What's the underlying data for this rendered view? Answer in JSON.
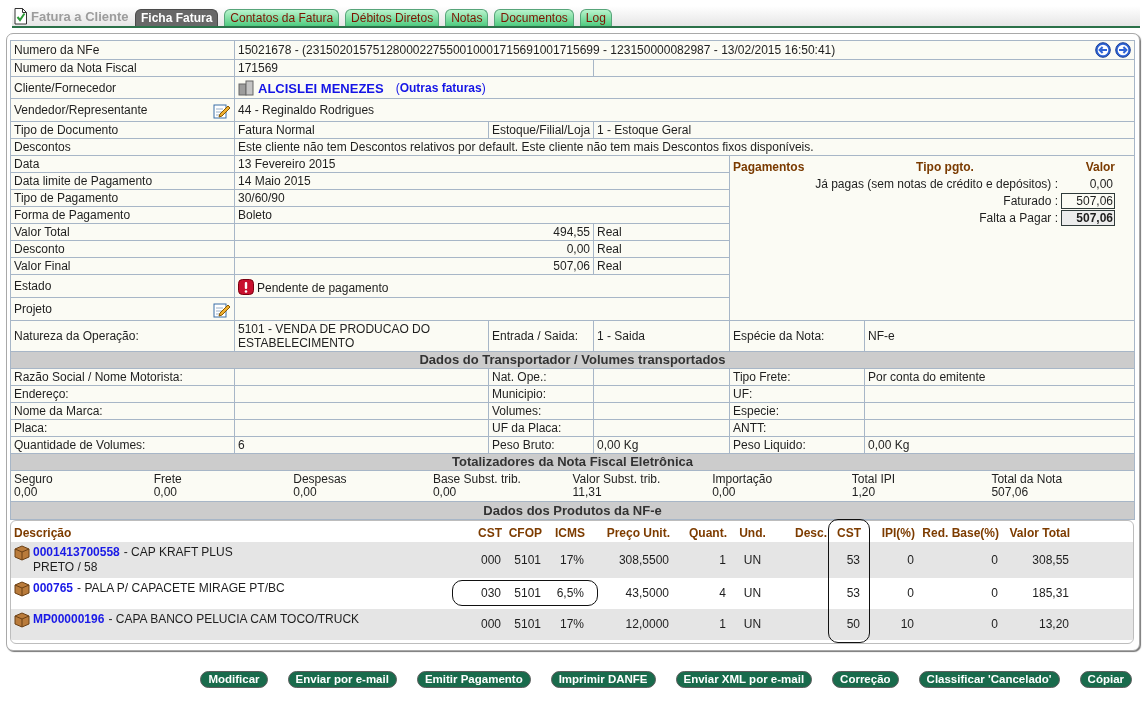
{
  "page": {
    "title": "Fatura a Cliente"
  },
  "tabs": [
    {
      "label": "Ficha Fatura",
      "selected": true
    },
    {
      "label": "Contatos da Fatura",
      "selected": false
    },
    {
      "label": "Débitos Diretos",
      "selected": false
    },
    {
      "label": "Notas",
      "selected": false
    },
    {
      "label": "Documentos",
      "selected": false
    },
    {
      "label": "Log",
      "selected": false
    }
  ],
  "details": {
    "nfe": {
      "label": "Numero da NFe",
      "value": "15021678 - (23150201575128000227550010001715691001715699 - 123150000082987 - 13/02/2015 16:50:41)"
    },
    "nota_fiscal": {
      "label": "Numero da Nota Fiscal",
      "value": "171569"
    },
    "client": {
      "label": "Cliente/Fornecedor",
      "name": "ALCISLEI MENEZES",
      "other_link": "(**Outras faturas**)"
    },
    "seller": {
      "label": "Vendedor/Representante",
      "value": "44 - Reginaldo Rodrigues"
    },
    "document": {
      "label": "Tipo de Documento",
      "value": "Fatura Normal",
      "stock_label": "Estoque/Filial/Loja",
      "stock_value": "1 - Estoque Geral"
    },
    "discounts": {
      "label": "Descontos",
      "value": "Este cliente não tem Descontos relativos por default. Este cliente não tem mais Descontos fixos disponíveis."
    },
    "fields": [
      {
        "label": "Data",
        "value": "13 Fevereiro 2015"
      },
      {
        "label": "Data limite de Pagamento",
        "value": "14 Maio 2015"
      },
      {
        "label": "Tipo de Pagamento",
        "value": "30/60/90"
      },
      {
        "label": "Forma de Pagamento",
        "value": "Boleto"
      }
    ],
    "amounts": [
      {
        "label": "Valor Total",
        "value": "494,55",
        "currency": "Real"
      },
      {
        "label": "Desconto",
        "value": "0,00",
        "currency": "Real"
      },
      {
        "label": "Valor Final",
        "value": "507,06",
        "currency": "Real"
      }
    ],
    "status": {
      "label": "Estado",
      "value": "Pendente de pagamento"
    },
    "project": {
      "label": "Projeto"
    },
    "operation": {
      "label": "Natureza da Operação:",
      "value": "5101 - VENDA DE PRODUCAO DO ESTABELECIMENTO",
      "io_label": "Entrada / Saida:",
      "io_value": "1 - Saida",
      "species_label": "Espécie da Nota:",
      "species_value": "NF-e"
    }
  },
  "payments": {
    "title": "Pagamentos",
    "type_heading": "Tipo pgto.",
    "value_heading": "Valor",
    "lines": [
      {
        "label": "Já pagas (sem notas de crédito e depósitos) :",
        "value": "0,00",
        "kind": "plain"
      },
      {
        "label": "Faturado :",
        "value": "507,06",
        "kind": "boxed"
      },
      {
        "label": "Falta a Pagar :",
        "value": "507,06",
        "kind": "total"
      }
    ]
  },
  "transport": {
    "title": "Dados do Transportador / Volumes transportados",
    "rows": [
      [
        {
          "label": "Razão Social / Nome Motorista:"
        },
        {
          "label": "Nat. Ope.:"
        },
        {
          "label": "Tipo Frete:",
          "value": "Por conta do emitente"
        }
      ],
      [
        {
          "label": "Endereço:"
        },
        {
          "label": "Municipio:"
        },
        {
          "label": "UF:"
        }
      ],
      [
        {
          "label": "Nome da Marca:"
        },
        {
          "label": "Volumes:"
        },
        {
          "label": "Especie:"
        }
      ],
      [
        {
          "label": "Placa:"
        },
        {
          "label": "UF da Placa:"
        },
        {
          "label": "ANTT:"
        }
      ],
      [
        {
          "label": "Quantidade de Volumes:",
          "value": "6"
        },
        {
          "label": "Peso Bruto:",
          "value": "0,00 Kg"
        },
        {
          "label": "Peso Liquido:",
          "value": "0,00 Kg"
        }
      ]
    ]
  },
  "totals": {
    "title": "Totalizadores da Nota Fiscal Eletrônica",
    "items": [
      {
        "label": "Seguro",
        "value": "0,00"
      },
      {
        "label": "Frete",
        "value": "0,00"
      },
      {
        "label": "Despesas",
        "value": "0,00"
      },
      {
        "label": "Base Subst. trib.",
        "value": "0,00"
      },
      {
        "label": "Valor Subst. trib.",
        "value": "11,31"
      },
      {
        "label": "Importação",
        "value": "0,00"
      },
      {
        "label": "Total IPI",
        "value": "1,20"
      },
      {
        "label": "Total da Nota",
        "value": "507,06"
      }
    ]
  },
  "products": {
    "title": "Dados dos Produtos da NF-e",
    "columns": [
      {
        "label": "Descrição",
        "highlighted": false
      },
      {
        "label": "CST",
        "highlighted": false
      },
      {
        "label": "CFOP",
        "highlighted": false
      },
      {
        "label": "ICMS",
        "highlighted": false
      },
      {
        "label": "Preço Unit.",
        "highlighted": false
      },
      {
        "label": "Quant.",
        "highlighted": false
      },
      {
        "label": "Und.",
        "highlighted": false
      },
      {
        "label": "Desc.",
        "highlighted": false
      },
      {
        "label": "CST",
        "highlighted": true
      },
      {
        "label": "IPI(%)",
        "highlighted": false
      },
      {
        "label": "Red. Base(%)",
        "highlighted": false
      },
      {
        "label": "Valor Total",
        "highlighted": false
      }
    ],
    "rows": [
      {
        "code": "0001413700558",
        "description": "- CAP KRAFT PLUS\nPRETO / 58",
        "values": [
          "000",
          "5101",
          "17%",
          "308,5500",
          "1",
          "UN",
          "53",
          "0",
          "0",
          "308,55"
        ],
        "highlighted": false
      },
      {
        "code": "000765",
        "description": "- PALA P/ CAPACETE MIRAGE PT/BC",
        "values": [
          "030",
          "5101",
          "6,5%",
          "43,5000",
          "4",
          "UN",
          "53",
          "0",
          "0",
          "185,31"
        ],
        "highlighted": true
      },
      {
        "code": "MP00000196",
        "description": "- CAPA BANCO PELUCIA CAM TOCO/TRUCK",
        "values": [
          "000",
          "5101",
          "17%",
          "12,0000",
          "1",
          "UN",
          "50",
          "10",
          "0",
          "13,20"
        ],
        "highlighted": false
      }
    ]
  },
  "actions": [
    "Modificar",
    "Enviar por e-mail",
    "Emitir Pagamento",
    "Imprimir DANFE",
    "Enviar XML por e-mail",
    "Correção",
    "Classificar 'Cancelado'",
    "Cópiar"
  ]
}
